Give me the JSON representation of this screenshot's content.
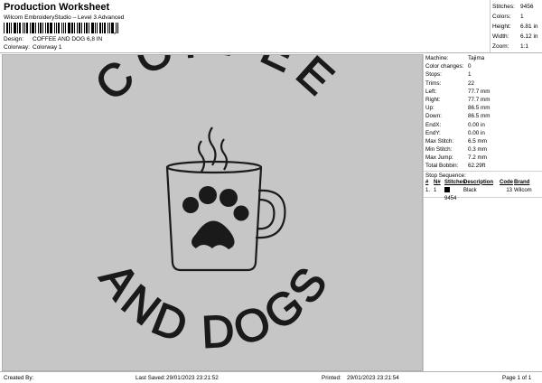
{
  "header": {
    "title": "Production Worksheet",
    "subtitle": "Wilcom EmbroideryStudio – Level 3 Advanced",
    "barcode_mark": ",",
    "design_label": "Design:",
    "design_value": "COFFEE AND DOG 6,8 IN",
    "colorway_label": "Colorway:",
    "colorway_value": "Colorway 1"
  },
  "stats": [
    {
      "label": "Stitches:",
      "value": "9456"
    },
    {
      "label": "Colors:",
      "value": "1"
    },
    {
      "label": "Height:",
      "value": "6.81 in"
    },
    {
      "label": "Width:",
      "value": "6.12 in"
    },
    {
      "label": "Zoom:",
      "value": "1:1"
    }
  ],
  "design": {
    "text_top": "COFFEE",
    "text_bottom": "AND DOGS",
    "thread_color": "#1a1a1a",
    "background_color": "#c6c6c6"
  },
  "machine": [
    {
      "label": "Machine:",
      "value": "Tajima"
    },
    {
      "label": "Color changes:",
      "value": "0"
    },
    {
      "label": "Stops:",
      "value": "1"
    },
    {
      "label": "Trims:",
      "value": "22"
    },
    {
      "label": "Left:",
      "value": "77.7 mm"
    },
    {
      "label": "Right:",
      "value": "77.7 mm"
    },
    {
      "label": "Up:",
      "value": "86.5 mm"
    },
    {
      "label": "Down:",
      "value": "86.5 mm"
    },
    {
      "label": "EndX:",
      "value": "0.00 in"
    },
    {
      "label": "EndY:",
      "value": "0.00 in"
    },
    {
      "label": "Max Stitch:",
      "value": "6.5 mm"
    },
    {
      "label": "Min Stitch:",
      "value": "0.3 mm"
    },
    {
      "label": "Max Jump:",
      "value": "7.2 mm"
    },
    {
      "label": "Total Bobbin:",
      "value": "62.29ft"
    }
  ],
  "stop_sequence": {
    "title": "Stop Sequence:",
    "headers": [
      "#",
      "N#",
      "Stitches",
      "Description",
      "Code",
      "Brand"
    ],
    "rows": [
      {
        "num": "1.",
        "n": "1",
        "stitches": "9454",
        "description": "Black",
        "code": "13",
        "brand": "Wilcom",
        "color": "#000000"
      }
    ]
  },
  "footer": {
    "created_by": "Created By:",
    "last_saved_label": "Last Saved:",
    "last_saved": "29/01/2023 23:21:52",
    "printed_label": "Printed:",
    "printed": "29/01/2023 23:21:54",
    "page": "Page 1 of 1"
  }
}
